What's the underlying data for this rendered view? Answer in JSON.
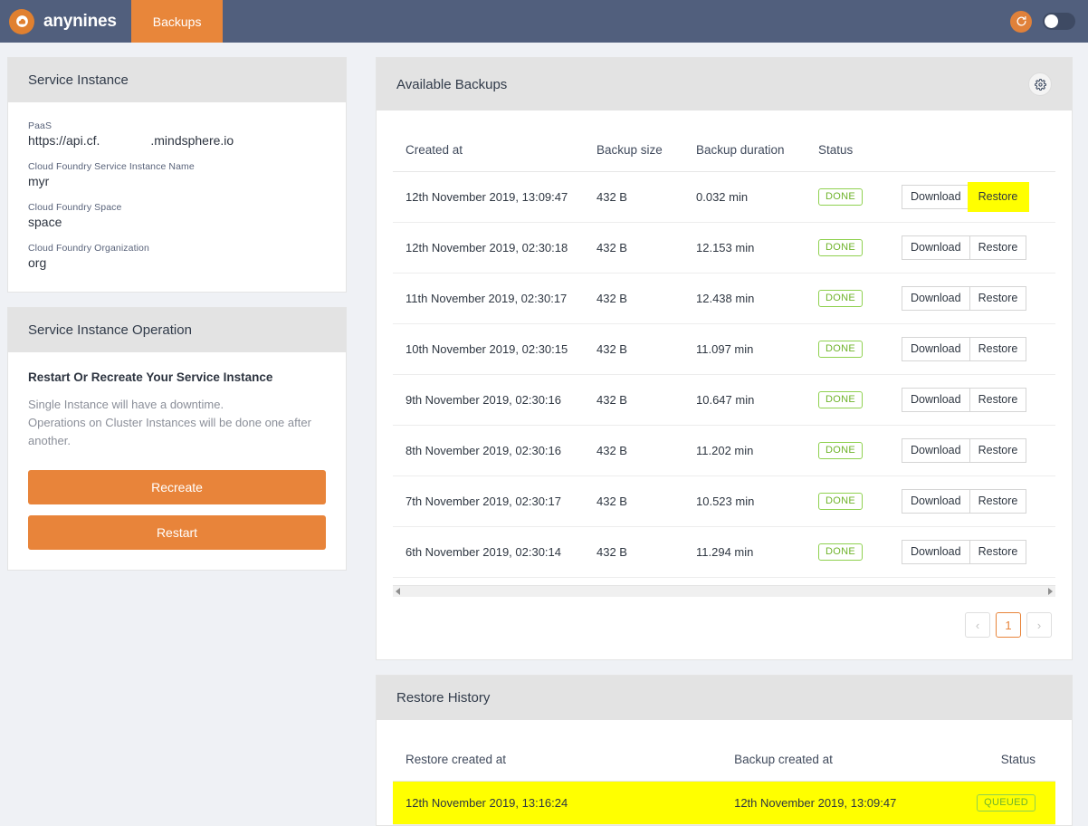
{
  "navbar": {
    "brand_name": "anynines",
    "brand_icon": "cloud-logo-icon",
    "tabs": [
      {
        "label": "Backups",
        "active": true
      }
    ],
    "refresh_icon": "refresh-icon",
    "toggle_state": "off"
  },
  "service_instance": {
    "title": "Service Instance",
    "fields": [
      {
        "label": "PaaS",
        "value_prefix": "https://api.cf.",
        "value_suffix": ".mindsphere.io",
        "redacted": true
      },
      {
        "label": "Cloud Foundry Service Instance Name",
        "value": "myr"
      },
      {
        "label": "Cloud Foundry Space",
        "value": "space"
      },
      {
        "label": "Cloud Foundry Organization",
        "value": "org"
      }
    ]
  },
  "service_instance_operation": {
    "title": "Service Instance Operation",
    "heading": "Restart Or Recreate Your Service Instance",
    "description": "Single Instance will have a downtime.\nOperations on Cluster Instances will be done one after another.",
    "recreate_label": "Recreate",
    "restart_label": "Restart"
  },
  "available_backups": {
    "title": "Available Backups",
    "settings_icon": "gear-icon",
    "columns": [
      "Created at",
      "Backup size",
      "Backup duration",
      "Status",
      ""
    ],
    "rows": [
      {
        "created_at": "12th November 2019, 13:09:47",
        "size": "432 B",
        "duration": "0.032 min",
        "status": "DONE",
        "download_label": "Download",
        "restore_label": "Restore",
        "restore_highlighted": true
      },
      {
        "created_at": "12th November 2019, 02:30:18",
        "size": "432 B",
        "duration": "12.153 min",
        "status": "DONE",
        "download_label": "Download",
        "restore_label": "Restore",
        "restore_highlighted": false
      },
      {
        "created_at": "11th November 2019, 02:30:17",
        "size": "432 B",
        "duration": "12.438 min",
        "status": "DONE",
        "download_label": "Download",
        "restore_label": "Restore",
        "restore_highlighted": false
      },
      {
        "created_at": "10th November 2019, 02:30:15",
        "size": "432 B",
        "duration": "11.097 min",
        "status": "DONE",
        "download_label": "Download",
        "restore_label": "Restore",
        "restore_highlighted": false
      },
      {
        "created_at": "9th November 2019, 02:30:16",
        "size": "432 B",
        "duration": "10.647 min",
        "status": "DONE",
        "download_label": "Download",
        "restore_label": "Restore",
        "restore_highlighted": false
      },
      {
        "created_at": "8th November 2019, 02:30:16",
        "size": "432 B",
        "duration": "11.202 min",
        "status": "DONE",
        "download_label": "Download",
        "restore_label": "Restore",
        "restore_highlighted": false
      },
      {
        "created_at": "7th November 2019, 02:30:17",
        "size": "432 B",
        "duration": "10.523 min",
        "status": "DONE",
        "download_label": "Download",
        "restore_label": "Restore",
        "restore_highlighted": false
      },
      {
        "created_at": "6th November 2019, 02:30:14",
        "size": "432 B",
        "duration": "11.294 min",
        "status": "DONE",
        "download_label": "Download",
        "restore_label": "Restore",
        "restore_highlighted": false
      }
    ],
    "pagination": {
      "prev": "‹",
      "pages": [
        "1"
      ],
      "current_page": "1",
      "next": "›"
    }
  },
  "restore_history": {
    "title": "Restore History",
    "columns": [
      "Restore created at",
      "Backup created at",
      "Status"
    ],
    "rows": [
      {
        "restore_created_at": "12th November 2019, 13:16:24",
        "backup_created_at": "12th November 2019, 13:09:47",
        "status": "QUEUED",
        "highlighted": true
      }
    ]
  },
  "colors": {
    "navbar_bg": "#515f7d",
    "accent_orange": "#e8843a",
    "status_green": "#6fb32b",
    "highlight_yellow": "#ffff00",
    "page_bg": "#eff1f5",
    "card_head_bg": "#e3e3e3"
  }
}
